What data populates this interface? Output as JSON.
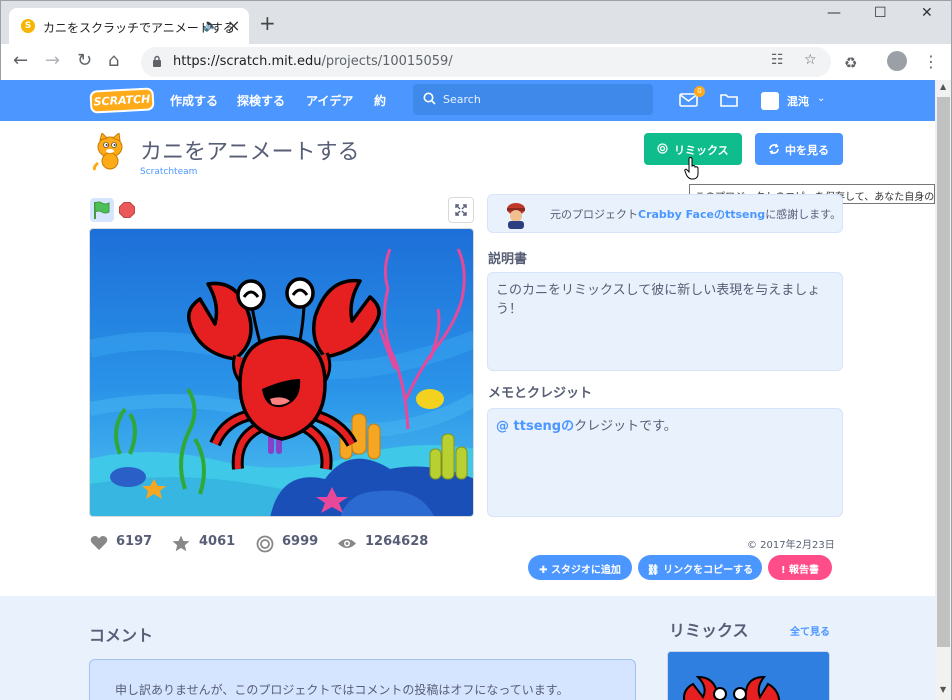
{
  "browser": {
    "tab_title": "カニをスクラッチでアニメートする",
    "url_host": "https://scratch.mit.edu",
    "url_path": "/projects/10015059/"
  },
  "nav": {
    "create": "作成する",
    "explore": "探検する",
    "ideas": "アイデア",
    "about": "約",
    "search_placeholder": "Search",
    "message_count": "0",
    "username": "混沌"
  },
  "project": {
    "title": "カニをアニメートする",
    "author": "Scratchteam",
    "remix_label": "リミックス",
    "see_inside_label": "中を見る",
    "tooltip": "このプロジェクトのコピーを保存して、あなた自身のアイデアを加えましょう"
  },
  "credit": {
    "prefix": "元のプロジェクト",
    "project_link": "Crabby Face",
    "connector": "の",
    "user_link": "ttseng",
    "suffix": "に感謝します。"
  },
  "instructions": {
    "heading": "説明書",
    "text": "このカニをリミックスして彼に新しい表現を与えましょう！"
  },
  "notes": {
    "heading": "メモとクレジット",
    "mention": "@ ttsengの",
    "text": "クレジットです。"
  },
  "stats": {
    "loves": "6197",
    "favorites": "4061",
    "remixes": "6999",
    "views": "1264628"
  },
  "date": "© 2017年2月23日",
  "actions": {
    "add_to_studio": "スタジオに追加",
    "copy_link": "リンクをコピーする",
    "report": "報告書"
  },
  "comments": {
    "heading": "コメント",
    "off_message": "申し訳ありませんが、このプロジェクトではコメントの投稿はオフになっています。"
  },
  "remixes_panel": {
    "heading": "リミックス",
    "see_all": "全て見る"
  },
  "colors": {
    "scratch_blue": "#4c97ff",
    "remix_green": "#0fbd8c",
    "report_pink": "#ff4d8a",
    "crab_red": "#e62020"
  }
}
